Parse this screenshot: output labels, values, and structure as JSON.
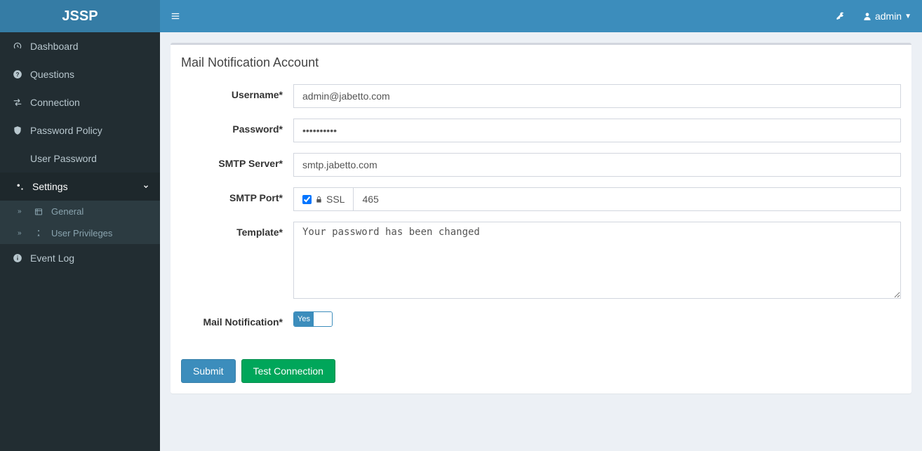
{
  "brand": "JSSP",
  "topbar": {
    "user_label": "admin"
  },
  "sidebar": {
    "items": [
      {
        "label": "Dashboard"
      },
      {
        "label": "Questions"
      },
      {
        "label": "Connection"
      },
      {
        "label": "Password Policy"
      },
      {
        "label": "User Password"
      },
      {
        "label": "Settings"
      },
      {
        "label": "Event Log"
      }
    ],
    "settings_children": [
      {
        "label": "General"
      },
      {
        "label": "User Privileges"
      }
    ]
  },
  "panel": {
    "title": "Mail Notification Account",
    "labels": {
      "username": "Username*",
      "password": "Password*",
      "smtp_server": "SMTP Server*",
      "smtp_port": "SMTP Port*",
      "template": "Template*",
      "mail_notification": "Mail Notification*",
      "ssl": "SSL"
    },
    "values": {
      "username": "admin@jabetto.com",
      "password": "••••••••••",
      "smtp_server": "smtp.jabetto.com",
      "smtp_port": "465",
      "template": "Your password has been changed",
      "ssl_checked": true,
      "mail_notification_on": "Yes"
    },
    "buttons": {
      "submit": "Submit",
      "test": "Test Connection"
    }
  }
}
